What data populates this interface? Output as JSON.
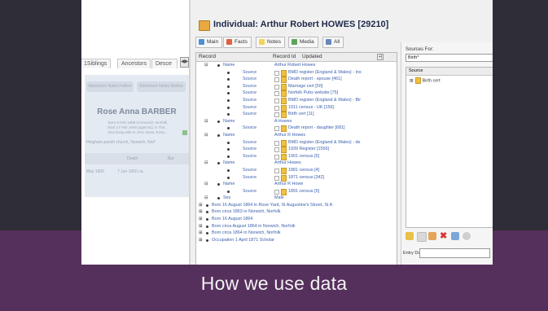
{
  "slide": {
    "caption": "How we use data",
    "colors": {
      "top_band": "#2f2d38",
      "bottom_band": "#56305c",
      "caption_text": "#f2f2f2"
    }
  },
  "left_pane": {
    "tabs": [
      "Siblings",
      "Ancestors",
      "Desce"
    ],
    "tab_prefix": "1",
    "pills": [
      "Adventure Notes Father",
      "Adventure Notes Mother"
    ],
    "person_name": "Rose Anna BARBER",
    "person_lines": [
      "Born 8 Feb 1888 in Norwich, Norfolk",
      "Died 17 Feb 1949 (aged 61) in The...",
      "Also living with in 1911 Norw, Rose..."
    ],
    "parish": "Heigham parish church, Norwich, Norf",
    "grid_headers": [
      "Death",
      "Bur"
    ],
    "grid_rows": [
      [
        "May 1900",
        "7 Jun 1900 ca.",
        ""
      ]
    ]
  },
  "window": {
    "title": "Individual: Arthur Robert HOWES [29210]",
    "toolbar": [
      {
        "label": "Main",
        "icon": "person-icon",
        "color": "#4e8fd6"
      },
      {
        "label": "Facts",
        "icon": "facts-icon",
        "color": "#e06040"
      },
      {
        "label": "Notes",
        "icon": "notes-icon",
        "color": "#f3d35a"
      },
      {
        "label": "Media",
        "icon": "media-icon",
        "color": "#5aa35a"
      },
      {
        "label": "All",
        "icon": "all-icon",
        "color": "#6688bb"
      }
    ],
    "grid": {
      "headers": [
        "Record",
        "Record Id",
        "Updated"
      ],
      "rows": [
        {
          "kind": "name",
          "label": "Name",
          "value": "Arthur Robert Howes"
        },
        {
          "kind": "src",
          "label": "Source",
          "value": "BMD register (England & Wales) - Ins"
        },
        {
          "kind": "src",
          "label": "Source",
          "value": "Death report - spouse [461]"
        },
        {
          "kind": "src",
          "label": "Source",
          "value": "Marriage cert [50]"
        },
        {
          "kind": "src",
          "label": "Source",
          "value": "Norfolk Pubs website [75]"
        },
        {
          "kind": "src",
          "label": "Source",
          "value": "BMD register (England & Wales) - Bir"
        },
        {
          "kind": "src",
          "label": "Source",
          "value": "1911 census - UK [156]"
        },
        {
          "kind": "src",
          "label": "Source",
          "value": "Birth cert [11]"
        },
        {
          "kind": "name",
          "label": "Name",
          "value": "A Howes"
        },
        {
          "kind": "src",
          "label": "Source",
          "value": "Death report - daughter [681]"
        },
        {
          "kind": "name",
          "label": "Name",
          "value": "Arthur R Howes"
        },
        {
          "kind": "src",
          "label": "Source",
          "value": "BMD register (England & Wales) - de"
        },
        {
          "kind": "src",
          "label": "Source",
          "value": "1939 Register [1556]"
        },
        {
          "kind": "src",
          "label": "Source",
          "value": "1901 census [6]"
        },
        {
          "kind": "name",
          "label": "Name",
          "value": "Arthur Howes"
        },
        {
          "kind": "src",
          "label": "Source",
          "value": "1881 census [4]"
        },
        {
          "kind": "src",
          "label": "Source",
          "value": "1871 census [342]"
        },
        {
          "kind": "name",
          "label": "Name",
          "value": "Arthur R Howe"
        },
        {
          "kind": "src",
          "label": "Source",
          "value": "1891 census [5]"
        },
        {
          "kind": "name",
          "label": "Sex",
          "value": "Male"
        },
        {
          "kind": "fact",
          "value": "Born 16 August 1864 in Rose Yard, St Augustine's Street, St A"
        },
        {
          "kind": "fact",
          "value": "Born circa 1863 in Norwich, Norfolk"
        },
        {
          "kind": "fact",
          "value": "Born 16 August 1864"
        },
        {
          "kind": "fact",
          "value": "Born circa August 1864 in Norwich, Norfolk"
        },
        {
          "kind": "fact",
          "value": "Born circa 1864 in Norwich, Norfolk"
        },
        {
          "kind": "fact",
          "value": "Occupation 1 April 1871 Scholar"
        }
      ]
    },
    "right_panel": {
      "sources_for_label": "Sources For:",
      "sources_for_value": "Birth*",
      "list_header": "Source",
      "list_item": "Birth cert",
      "entry_date_label": "Entry Date:"
    }
  }
}
